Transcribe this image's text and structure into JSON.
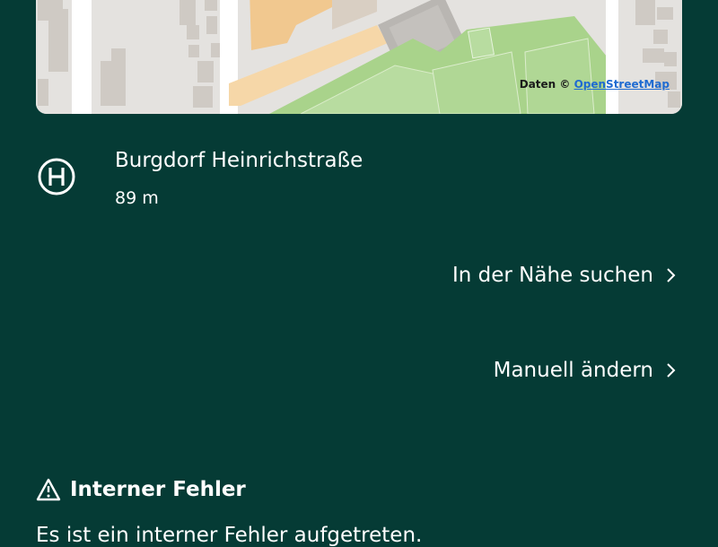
{
  "map": {
    "attribution_prefix": "Daten ©",
    "attribution_link": "OpenStreetMap"
  },
  "stop": {
    "icon": "bus-stop-h-icon",
    "name": "Burgdorf Heinrichstraße",
    "distance": "89 m"
  },
  "actions": {
    "nearby_label": "In der Nähe suchen",
    "manual_label": "Manuell ändern"
  },
  "error": {
    "icon": "warning-triangle-icon",
    "title": "Interner Fehler",
    "message": "Es ist ein interner Fehler aufgetreten."
  },
  "colors": {
    "background": "#053b35",
    "text": "#ffffff",
    "link": "#1f6bd1"
  }
}
